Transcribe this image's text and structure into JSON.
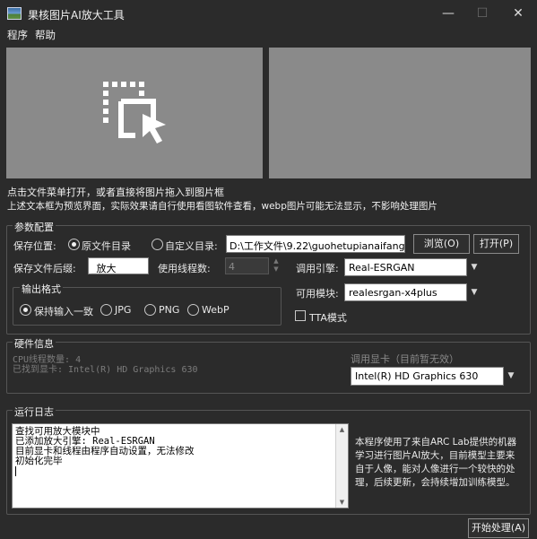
{
  "window": {
    "title": "果核图片AI放大工具"
  },
  "menu": [
    {
      "label": "程序"
    },
    {
      "label": "帮助"
    }
  ],
  "hints": {
    "line1": "点击文件菜单打开，或者直接将图片拖入到图片框",
    "line2": "上述文本框为预览界面，实际效果请自行使用看图软件查看，webp图片可能无法显示，不影响处理图片"
  },
  "params": {
    "group_label": "参数配置",
    "save_location_label": "保存位置:",
    "radio_original": "原文件目录",
    "radio_custom": "自定义目录:",
    "custom_path": "D:\\工作文件\\9.22\\guohetupianaifangda\\",
    "browse_button": "浏览(O)",
    "open_button": "打开(P)",
    "suffix_label": "保存文件后缀:",
    "suffix_value": "_放大",
    "threads_label": "使用线程数:",
    "threads_value": "4",
    "engine_label": "调用引擎:",
    "engine_value": "Real-ESRGAN",
    "model_label": "可用模块:",
    "model_value": "realesrgan-x4plus",
    "tta_label": "TTA模式",
    "format_group_label": "输出格式",
    "formats": [
      {
        "label": "保持输入一致"
      },
      {
        "label": "JPG"
      },
      {
        "label": "PNG"
      },
      {
        "label": "WebP"
      }
    ]
  },
  "hardware": {
    "group_label": "硬件信息",
    "cpu_threads": "CPU线程数量: 4",
    "gpu_found": "已找到显卡: Intel(R) HD Graphics 630",
    "gpu_select_label": "调用显卡（目前暂无效）",
    "gpu_select_value": "Intel(R) HD Graphics 630"
  },
  "log": {
    "group_label": "运行日志",
    "lines": [
      "查找可用放大模块中",
      "已添加放大引擎: Real-ESRGAN",
      "目前显卡和线程由程序自动设置，无法修改",
      "初始化完毕"
    ],
    "info": "本程序使用了来自ARC Lab提供的机器学习进行图片AI放大，目前模型主要来自于人像，能对人像进行一个较快的处理，后续更新，会持续增加训练模型。"
  },
  "start_button": "开始处理(A)"
}
